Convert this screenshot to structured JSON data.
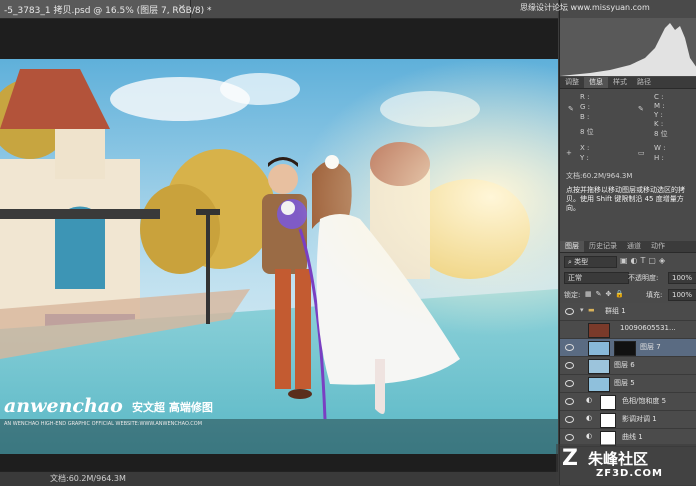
{
  "document": {
    "tab_title": "-5_3783_1 拷贝.psd @ 16.5% (图层 7, RGB/8) *",
    "tab_close": "×",
    "status_text": "文档:60.2M/964.3M"
  },
  "panel_tabs": [
    "调整",
    "信息",
    "样式",
    "路径"
  ],
  "info": {
    "left_labels": [
      "R :",
      "G :",
      "B :"
    ],
    "right_labels": [
      "C :",
      "M :",
      "Y :",
      "K :"
    ],
    "bit_left": "8 位",
    "bit_right": "8 位",
    "xy_labels": [
      "X :",
      "Y :"
    ],
    "wh_labels": [
      "W :",
      "H :"
    ],
    "doc_size": "文档:60.2M/964.3M",
    "hint": "点按并拖移以移动图层或移动选区的拷贝。使用 Shift 键限制沿 45 度增量方向。"
  },
  "layers_tabs": [
    "图层",
    "历史记录",
    "通道",
    "动作"
  ],
  "layers_filter": "类型",
  "blend_mode": "正常",
  "opacity_label": "不透明度:",
  "opacity_value": "100%",
  "lock_label": "锁定:",
  "fill_label": "填充:",
  "fill_value": "100%",
  "group_name": "群组 1",
  "layers": [
    {
      "name": "10090605531...",
      "selected": false,
      "eye": false,
      "thumb": "#7a3a2a"
    },
    {
      "name": "图层 7",
      "selected": true,
      "eye": true,
      "thumb": "#88b8d8"
    },
    {
      "name": "图层 6",
      "selected": false,
      "eye": true,
      "thumb": "#9cc4dc"
    },
    {
      "name": "图层 5",
      "selected": false,
      "eye": true,
      "thumb": "#8fc0dc"
    },
    {
      "name": "色相/饱和度 5",
      "selected": false,
      "eye": true,
      "thumb": "#ffffff"
    },
    {
      "name": "影调对调 1",
      "selected": false,
      "eye": true,
      "thumb": "#ffffff"
    },
    {
      "name": "曲线 1",
      "selected": false,
      "eye": true,
      "thumb": "#ffffff"
    }
  ],
  "watermark": {
    "brand": "anwenchao",
    "brand_cn": "安文超 高端修图",
    "tagline": "AN WENCHAO HIGH-END GRAPHIC OFFICIAL WEBSITE:WWW.ANWENCHAO.COM"
  },
  "site_mark_top": "思缘设计论坛 www.missyuan.com",
  "site_mark_bottom": "朱峰社区",
  "site_mark_url": "ZF3D.COM"
}
